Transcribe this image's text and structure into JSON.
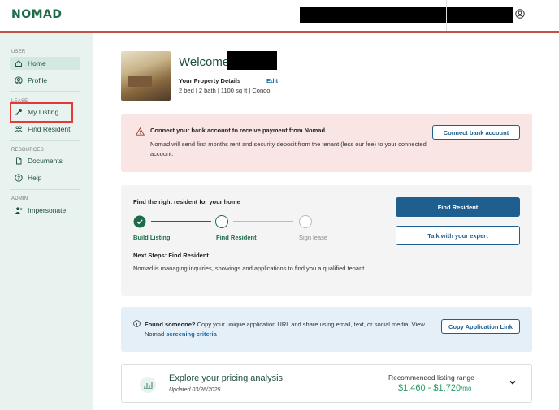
{
  "app": {
    "logo": "NOMAD"
  },
  "sidebar": {
    "sections": [
      {
        "label": "USER",
        "items": [
          {
            "label": "Home",
            "icon": "home-icon"
          },
          {
            "label": "Profile",
            "icon": "profile-icon"
          }
        ]
      },
      {
        "label": "LEASE",
        "items": [
          {
            "label": "My Listing",
            "icon": "key-icon"
          },
          {
            "label": "Find Resident",
            "icon": "people-icon"
          }
        ]
      },
      {
        "label": "RESOURCES",
        "items": [
          {
            "label": "Documents",
            "icon": "document-icon"
          },
          {
            "label": "Help",
            "icon": "help-icon"
          }
        ]
      },
      {
        "label": "ADMIN",
        "items": [
          {
            "label": "Impersonate",
            "icon": "impersonate-icon"
          }
        ]
      }
    ],
    "active_item": "Home"
  },
  "welcome": {
    "greeting": "Welcome,",
    "property_title": "Your Property Details",
    "edit_label": "Edit",
    "property_details": "2 bed | 2 bath | 1100 sq ft | Condo"
  },
  "alert": {
    "title": "Connect your bank account to receive payment from Nomad.",
    "text": "Nomad will send first months rent and security deposit from the tenant (less our fee) to your connected account.",
    "button": "Connect bank account"
  },
  "resident_card": {
    "title": "Find the right resident for your home",
    "steps": [
      {
        "label": "Build Listing",
        "status": "complete"
      },
      {
        "label": "Find Resident",
        "status": "current"
      },
      {
        "label": "Sign lease",
        "status": "upcoming"
      }
    ],
    "next_title": "Next Steps: Find Resident",
    "next_text": "Nomad is managing inquiries, showings and applications to find you a qualified tenant.",
    "primary_button": "Find Resident",
    "secondary_button": "Talk with your expert"
  },
  "info": {
    "bold": "Found someone?",
    "text": " Copy your unique application URL and share using email, text, or social media. View Nomad ",
    "link": "screening criteria",
    "button": "Copy Application Link"
  },
  "pricing": {
    "title": "Explore your pricing analysis",
    "updated": "Updated 03/26/2025",
    "range_label": "Recommended listing range",
    "range_value": "$1,460 - $1,720",
    "range_unit": "/mo"
  },
  "colors": {
    "brand": "#1d6a4a",
    "accent": "#1e5f8f",
    "alert_bg": "#f9e6e4",
    "highlight": "#e53935"
  }
}
